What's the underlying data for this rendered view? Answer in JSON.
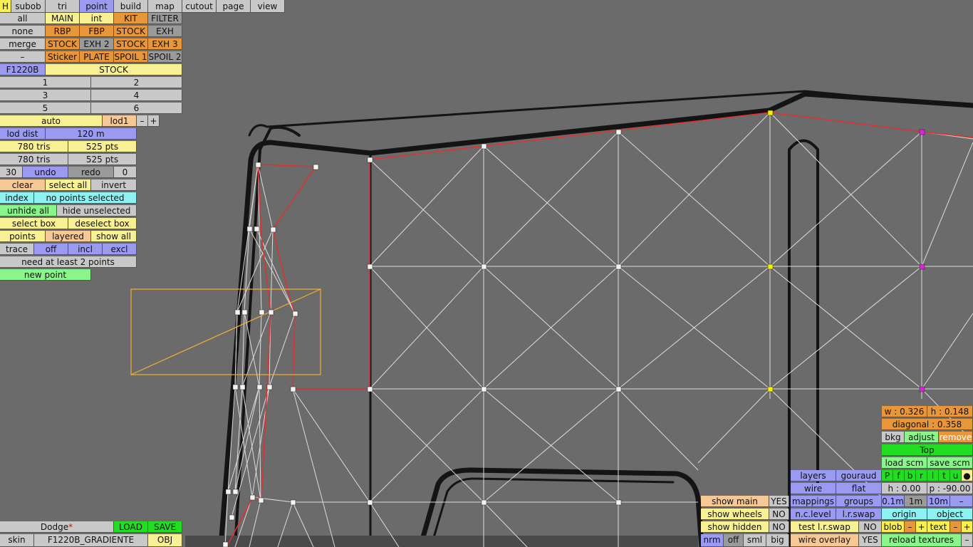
{
  "menu": {
    "h": "H",
    "tabs": [
      "subob",
      "tri",
      "point",
      "build",
      "map",
      "cutout",
      "page",
      "view"
    ]
  },
  "left": {
    "sel_all": "all",
    "sel_none": "none",
    "sel_merge": "merge",
    "sel_dash": "–",
    "parts": [
      "MAIN",
      "int",
      "KIT",
      "FILTER",
      "RBP",
      "FBP",
      "STOCK",
      "EXH",
      "STOCK",
      "EXH 2",
      "STOCK",
      "EXH 3",
      "Sticker",
      "PLATE",
      "SPOIL 1",
      "SPOIL 2"
    ],
    "model": "F1220B",
    "variant": "STOCK",
    "nums": [
      "1",
      "2",
      "3",
      "4",
      "5",
      "6"
    ],
    "auto": "auto",
    "lod": "lod1",
    "minus": "–",
    "plus": "+",
    "lod_dist_label": "lod dist",
    "lod_dist_value": "120 m",
    "tris1": "780 tris",
    "pts1": "525 pts",
    "tris2": "780 tris",
    "pts2": "525 pts",
    "undo_count": "30",
    "undo": "undo",
    "redo": "redo",
    "redo_count": "0",
    "clear": "clear",
    "select_all": "select all",
    "invert": "invert",
    "index": "index",
    "no_points": "no points selected",
    "unhide_all": "unhide all",
    "hide_unselected": "hide unselected",
    "select_box": "select box",
    "deselect_box": "deselect box",
    "points": "points",
    "layered": "layered",
    "show_all": "show all",
    "trace": "trace",
    "off": "off",
    "incl": "incl",
    "excl": "excl",
    "need": "need at least 2 points",
    "new_point": "new point"
  },
  "bottom_left": {
    "car": "Dodge",
    "star": "*",
    "load": "LOAD",
    "save": "SAVE",
    "skin": "skin",
    "skin_name": "F1220B_GRADIENTE",
    "obj": "OBJ"
  },
  "bottom_mid": {
    "show_main": "show main",
    "show_main_v": "YES",
    "show_wheels": "show wheels",
    "show_wheels_v": "NO",
    "show_hidden": "show hidden",
    "show_hidden_v": "NO",
    "nrm": "nrm",
    "off": "off",
    "sml": "sml",
    "big": "big"
  },
  "bottom_right": {
    "w": "w : 0.326",
    "h": "h : 0.148",
    "diagonal": "diagonal : 0.358",
    "bkg": "bkg",
    "adjust": "adjust",
    "remove": "remove",
    "top": "Top",
    "load_scm": "load scm",
    "save_scm": "save scm",
    "flags": [
      "P",
      "f",
      "b",
      "r",
      "l",
      "t",
      "u",
      "●"
    ],
    "layers": "layers",
    "gouraud": "gouraud",
    "wire": "wire",
    "flat": "flat",
    "h0": "h : 0.00",
    "p": "p : -90.00",
    "mappings": "mappings",
    "groups": "groups",
    "d1": "0.1m",
    "d2": "1m",
    "d3": "10m",
    "dm": "–",
    "nclevel": "n.c.level",
    "lrswap": "l.r.swap",
    "origin": "origin",
    "object": "object",
    "test_lr": "test l.r.swap",
    "test_lr_v": "NO",
    "blob": "blob",
    "text": "text",
    "wire_overlay": "wire overlay",
    "wire_overlay_v": "YES",
    "reload": "reload textures"
  }
}
